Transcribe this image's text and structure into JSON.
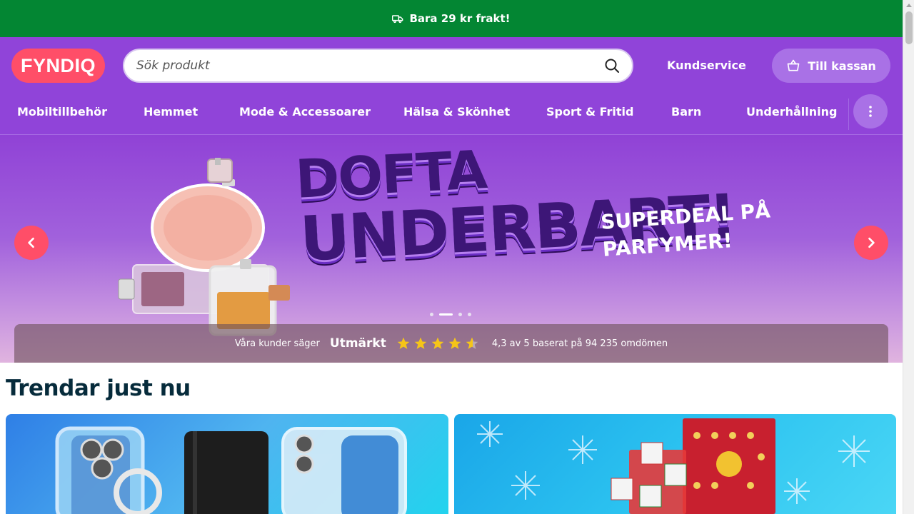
{
  "topbar": {
    "text": "Bara 29 kr frakt!",
    "icon": "truck-icon"
  },
  "header": {
    "logo": "FYNDIQ",
    "search_placeholder": "Sök produkt",
    "customer_service": "Kundservice",
    "checkout": "Till kassan"
  },
  "nav": {
    "items": [
      {
        "label": "Mobiltillbehör"
      },
      {
        "label": "Hemmet"
      },
      {
        "label": "Mode & Accessoarer"
      },
      {
        "label": "Hälsa & Skönhet"
      },
      {
        "label": "Sport & Fritid"
      },
      {
        "label": "Barn"
      },
      {
        "label": "Underhållning"
      }
    ]
  },
  "hero": {
    "title_line1": "DOFTA",
    "title_line2": "UNDERBART!",
    "subtitle_line1": "SUPERDEAL PÅ",
    "subtitle_line2": "PARFYMER!",
    "slide_count": 4,
    "active_slide": 2
  },
  "reviews": {
    "label": "Våra kunder säger",
    "rating_word": "Utmärkt",
    "rating": 4.3,
    "summary": "4,3 av 5 baserat på 94 235 omdömen"
  },
  "trending": {
    "title": "Trendar just nu"
  },
  "colors": {
    "topbar_bg": "#038633",
    "brand_purple": "#9044d9",
    "accent_pink": "#ff4e68",
    "star_yellow": "#f5c518",
    "heading_dark": "#062b3b"
  }
}
